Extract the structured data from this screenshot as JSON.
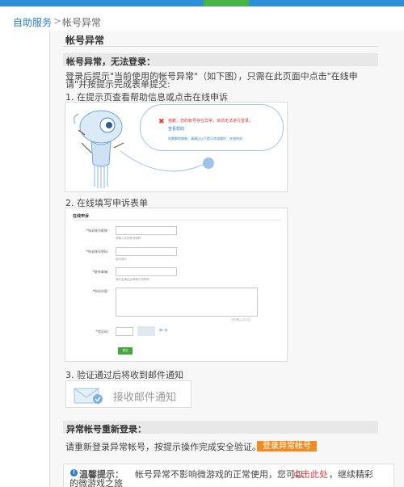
{
  "breadcrumb": {
    "home": "自助服务",
    "separator": ">",
    "current": "帐号异常"
  },
  "page_title": "帐号异常",
  "section1": {
    "heading": "帐号异常，无法登录：",
    "intro_line1": "登录后提示\"当前使用的帐号异常\"（如下图），只需在此页面中点击\"在线申",
    "intro_line2": "请\"并按提示完成表单提交:",
    "step1": "1. 在提示页查看帮助信息或点击在线申诉",
    "step2": "2. 在线填写申诉表单",
    "step3": "3. 验证通过后将收到邮件通知"
  },
  "screenshot1": {
    "error_icon": "error-x-icon",
    "error_message": "抱歉，您的帐号存在异常，目前无法进行登录。",
    "help_link": "查看帮助",
    "tip": "如需解除限制，请通过以下提示完成操作：在线申诉"
  },
  "screenshot2": {
    "title": "在线申诉",
    "fields": [
      {
        "label": "申诉帐号昵称：",
        "hint": "请输入你的帐号昵称"
      },
      {
        "label": "申诉帐号密码：",
        "hint": "密码提示"
      },
      {
        "label": "联系邮箱：",
        "hint": "我们会通过此邮箱与您联系"
      },
      {
        "label": "申诉内容：",
        "hint": ""
      }
    ],
    "textarea_count": "还可输入300字",
    "captcha_label": "验证码：",
    "captcha_refresh": "换一张",
    "submit": "提交"
  },
  "mail_notice": {
    "label": "接收邮件通知",
    "icon": "mail-check-icon"
  },
  "section2": {
    "heading": "异常帐号重新登录：",
    "instruction": "请重新登录异常帐号，按提示操作完成安全验证。",
    "button": "登录异常帐号"
  },
  "tip": {
    "head": "温馨提示：",
    "body": "帐号异常不影响微游戏的正常使用，您可以",
    "link": "点击此处",
    "tail": "，继续精彩",
    "wrap": "的微游戏之旅"
  },
  "colors": {
    "link": "#2a7fc6",
    "accent_orange": "#f08d22",
    "nav_blue": "#2d8fd5",
    "nav_active": "#46b548"
  }
}
